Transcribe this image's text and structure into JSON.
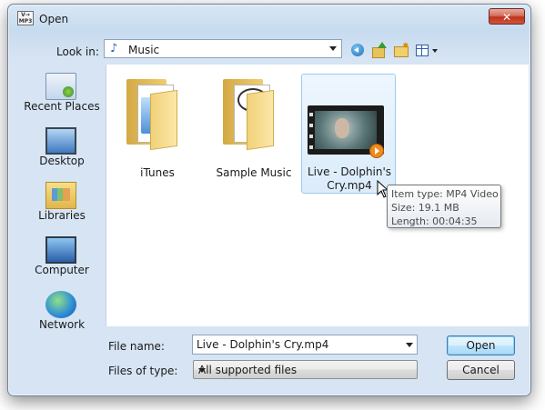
{
  "window": {
    "title": "Open",
    "app_icon_text": "V→ MP3",
    "close_symbol": "✕"
  },
  "toolbar": {
    "look_in_label": "Look in:",
    "look_in_value": "Music",
    "icons": [
      "back-icon",
      "up-folder-icon",
      "new-folder-icon",
      "views-menu-icon"
    ]
  },
  "places": [
    {
      "label": "Recent Places",
      "icon": "recent-places-icon"
    },
    {
      "label": "Desktop",
      "icon": "desktop-icon"
    },
    {
      "label": "Libraries",
      "icon": "libraries-icon"
    },
    {
      "label": "Computer",
      "icon": "computer-icon"
    },
    {
      "label": "Network",
      "icon": "network-icon"
    }
  ],
  "files": [
    {
      "label": "iTunes",
      "icon": "folder-icon",
      "selected": false
    },
    {
      "label": "Sample Music",
      "icon": "folder-icon",
      "selected": false
    },
    {
      "label": "Live - Dolphin's Cry.mp4",
      "label_line1": "Live - Dolphin's",
      "label_line2": "Cry.mp4",
      "icon": "video-thumbnail-icon",
      "selected": true
    }
  ],
  "tooltip": {
    "item_type": "Item type: MP4 Video",
    "size": "Size: 19.1 MB",
    "length": "Length: 00:04:35"
  },
  "footer": {
    "file_name_label": "File name:",
    "file_name_value": "Live - Dolphin's Cry.mp4",
    "files_of_type_label": "Files of type:",
    "files_of_type_value": "All supported files",
    "open_label": "Open",
    "cancel_label": "Cancel"
  },
  "colors": {
    "accent": "#3c7fb1",
    "close_button": "#c1321c",
    "selection": "#dbecfb"
  }
}
